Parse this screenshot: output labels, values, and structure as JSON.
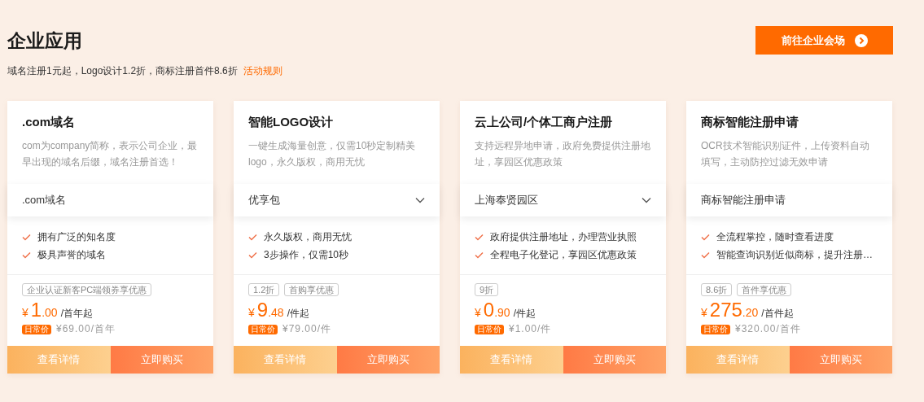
{
  "header": {
    "title": "企业应用",
    "subtitle": "域名注册1元起，Logo设计1.2折，商标注册首件8.6折",
    "rules_link": "活动规则",
    "cta_button": "前往企业会场"
  },
  "cards": [
    {
      "title": ".com域名",
      "description": "com为company简称，表示公司企业，最早出现的域名后缀，域名注册首选！",
      "option": {
        "label": ".com域名",
        "has_dropdown": false
      },
      "features": [
        "拥有广泛的知名度",
        "极具声誉的域名"
      ],
      "tags": [
        "企业认证新客PC端领券享优惠"
      ],
      "price": {
        "currency": "¥",
        "integer": "1",
        "decimal": ".00",
        "unit": "/首年起"
      },
      "regular_badge": "日常价",
      "regular_price": "¥69.00/首年",
      "buttons": {
        "details": "查看详情",
        "buy": "立即购买"
      }
    },
    {
      "title": "智能LOGO设计",
      "description": "一键生成海量创意，仅需10秒定制精美logo，永久版权，商用无忧",
      "option": {
        "label": "优享包",
        "has_dropdown": true
      },
      "features": [
        "永久版权，商用无忧",
        "3步操作，仅需10秒"
      ],
      "tags": [
        "1.2折",
        "首购享优惠"
      ],
      "price": {
        "currency": "¥",
        "integer": "9",
        "decimal": ".48",
        "unit": "/件起"
      },
      "regular_badge": "日常价",
      "regular_price": "¥79.00/件",
      "buttons": {
        "details": "查看详情",
        "buy": "立即购买"
      }
    },
    {
      "title": "云上公司/个体工商户注册",
      "description": "支持远程异地申请，政府免费提供注册地址，享园区优惠政策",
      "option": {
        "label": "上海奉贤园区",
        "has_dropdown": true
      },
      "features": [
        "政府提供注册地址，办理营业执照",
        "全程电子化登记，享园区优惠政策"
      ],
      "tags": [
        "9折"
      ],
      "price": {
        "currency": "¥",
        "integer": "0",
        "decimal": ".90",
        "unit": "/件起"
      },
      "regular_badge": "日常价",
      "regular_price": "¥1.00/件",
      "buttons": {
        "details": "查看详情",
        "buy": "立即购买"
      }
    },
    {
      "title": "商标智能注册申请",
      "description": "OCR技术智能识别证件，上传资料自动填写，主动防控过滤无效申请",
      "option": {
        "label": "商标智能注册申请",
        "has_dropdown": false
      },
      "features": [
        "全流程掌控，随时查看进度",
        "智能查询识别近似商标，提升注册…"
      ],
      "tags": [
        "8.6折",
        "首件享优惠"
      ],
      "price": {
        "currency": "¥",
        "integer": "275",
        "decimal": ".20",
        "unit": "/首件起"
      },
      "regular_badge": "日常价",
      "regular_price": "¥320.00/首件",
      "buttons": {
        "details": "查看详情",
        "buy": "立即购买"
      }
    }
  ]
}
